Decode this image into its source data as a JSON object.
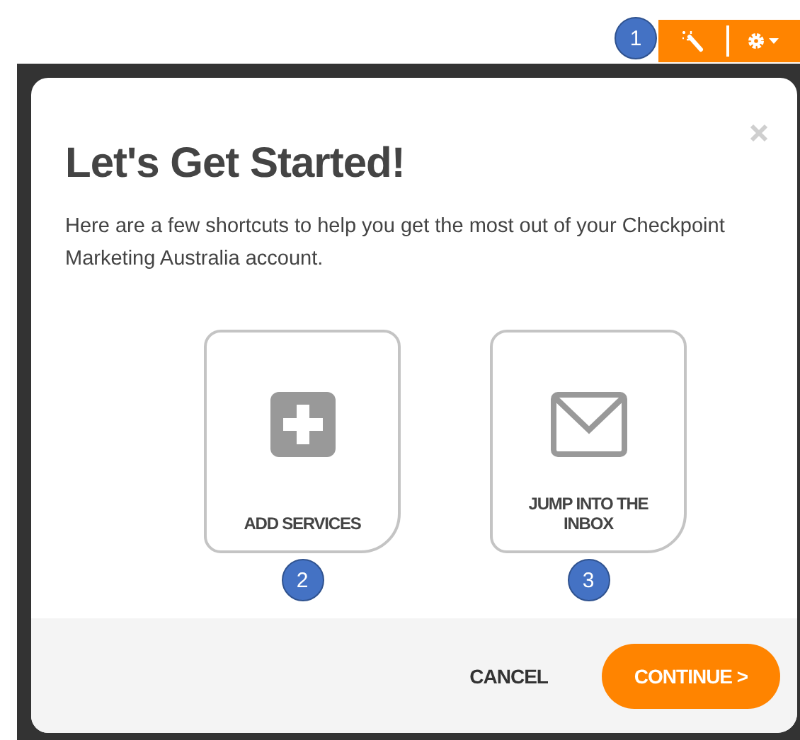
{
  "toolbar": {
    "callout": "1"
  },
  "dialog": {
    "title": "Let's Get Started!",
    "text": "Here are a few shortcuts to help you get the most out of your Checkpoint Marketing Australia account.",
    "shortcuts": [
      {
        "kind": "add",
        "label": "ADD SERVICES",
        "callout": "2"
      },
      {
        "kind": "inbox",
        "label": "JUMP INTO THE INBOX",
        "callout": "3"
      }
    ],
    "cancel": "CANCEL",
    "continue": "CONTINUE >"
  }
}
